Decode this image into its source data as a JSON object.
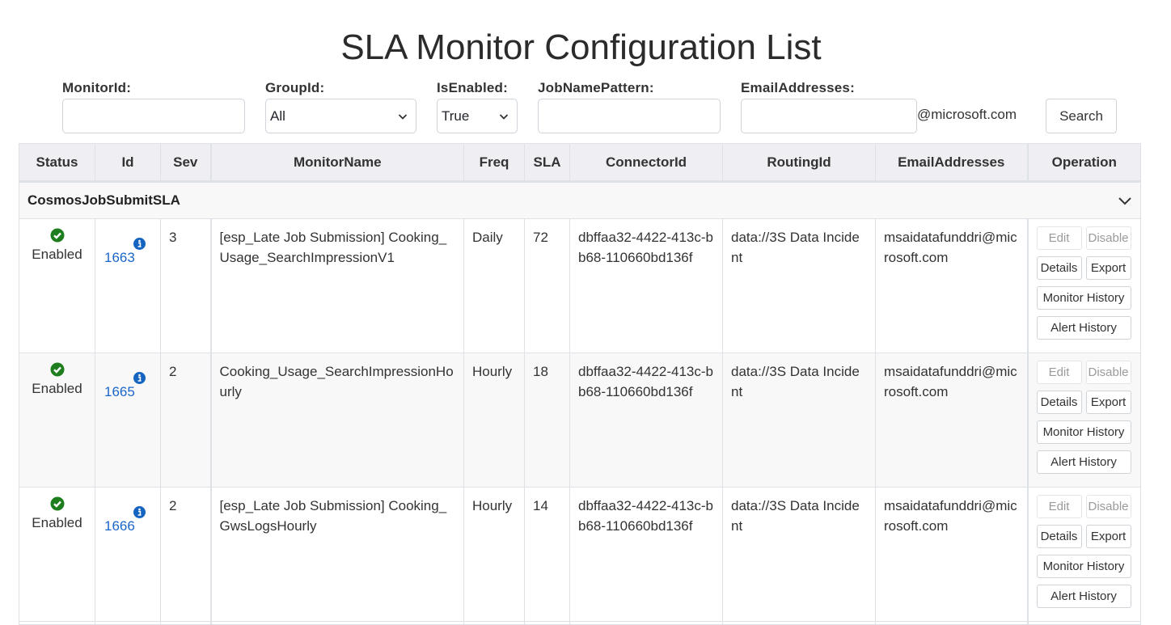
{
  "page": {
    "title": "SLA Monitor Configuration List"
  },
  "filters": {
    "monitor_id": {
      "label": "MonitorId:",
      "value": "",
      "placeholder": ""
    },
    "group_id": {
      "label": "GroupId:",
      "selected": "All"
    },
    "is_enabled": {
      "label": "IsEnabled:",
      "selected": "True"
    },
    "job_name_pattern": {
      "label": "JobNamePattern:",
      "value": "",
      "placeholder": ""
    },
    "email_addresses": {
      "label": "EmailAddresses:",
      "value": "",
      "placeholder": "",
      "suffix": "@microsoft.com"
    },
    "search_label": "Search"
  },
  "table": {
    "headers": [
      "Status",
      "Id",
      "Sev",
      "MonitorName",
      "Freq",
      "SLA",
      "ConnectorId",
      "RoutingId",
      "EmailAddresses",
      "Operation"
    ],
    "group": {
      "name": "CosmosJobSubmitSLA"
    },
    "operations": {
      "edit": "Edit",
      "disable": "Disable",
      "details": "Details",
      "export": "Export",
      "monitor_history": "Monitor History",
      "alert_history": "Alert History"
    },
    "rows": [
      {
        "status": "Enabled",
        "id": "1663",
        "sev": "3",
        "monitor_name": "[esp_Late Job Submission] Cooking_Usage_SearchImpressionV1",
        "freq": "Daily",
        "sla": "72",
        "connector_id": "dbffaa32-4422-413c-bb68-110660bd136f",
        "routing_id": "data://3S Data Incident",
        "email": "msaidatafunddri@microsoft.com"
      },
      {
        "status": "Enabled",
        "id": "1665",
        "sev": "2",
        "monitor_name": "Cooking_Usage_SearchImpressionHourly",
        "freq": "Hourly",
        "sla": "18",
        "connector_id": "dbffaa32-4422-413c-bb68-110660bd136f",
        "routing_id": "data://3S Data Incident",
        "email": "msaidatafunddri@microsoft.com"
      },
      {
        "status": "Enabled",
        "id": "1666",
        "sev": "2",
        "monitor_name": "[esp_Late Job Submission] Cooking_GwsLogsHourly",
        "freq": "Hourly",
        "sla": "14",
        "connector_id": "dbffaa32-4422-413c-bb68-110660bd136f",
        "routing_id": "data://3S Data Incident",
        "email": "msaidatafunddri@microsoft.com"
      }
    ]
  },
  "colors": {
    "status_enabled": "#1e7e1e",
    "info_icon": "#1565c0",
    "link": "#1b66c9",
    "header_bg": "#eeeef3"
  }
}
